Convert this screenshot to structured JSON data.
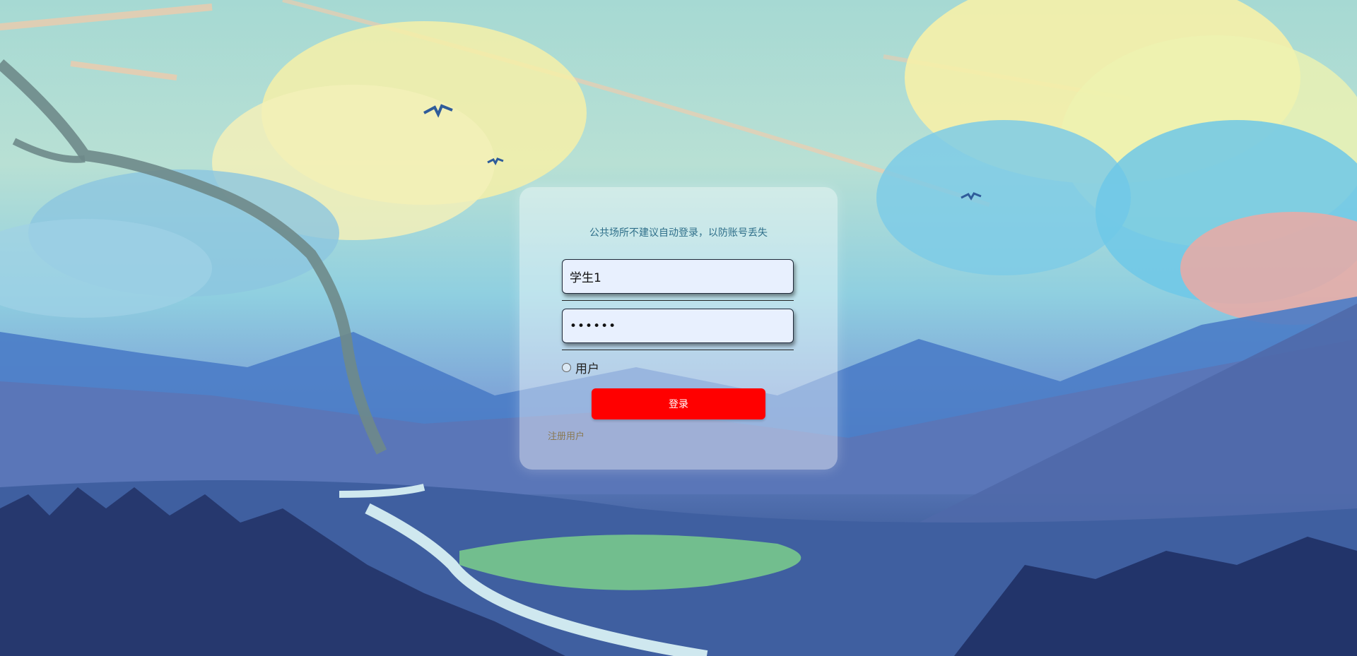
{
  "login": {
    "tip": "公共场所不建议自动登录，以防账号丢失",
    "username_value": "学生1",
    "password_value": "••••••",
    "role_label": "用户",
    "submit_label": "登录",
    "register_label": "注册用户"
  },
  "colors": {
    "button": "#ff0000",
    "input_bg": "#e8f0fe",
    "tip_text": "#2f6f8a",
    "register_text": "#8a7a55"
  }
}
